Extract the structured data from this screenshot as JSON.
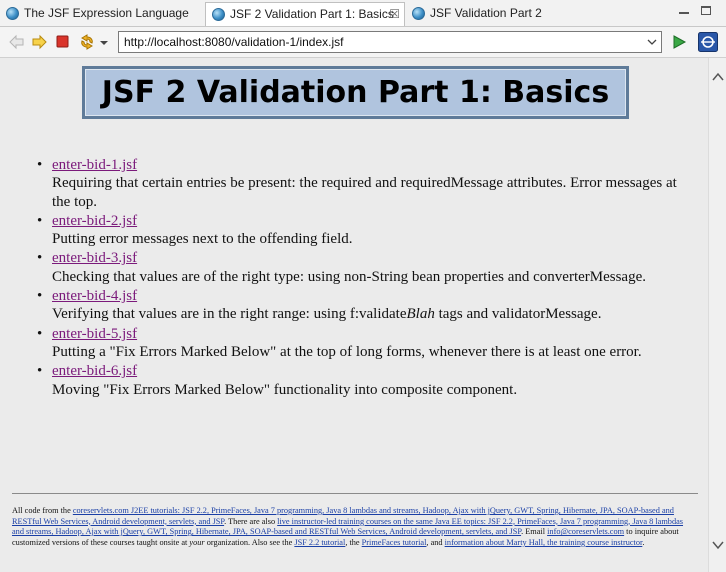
{
  "tabs": [
    {
      "label": "The JSF Expression Language"
    },
    {
      "label": "JSF 2 Validation Part 1: Basics",
      "close": "☒"
    },
    {
      "label": "JSF Validation Part 2"
    }
  ],
  "toolbar": {
    "url": "http://localhost:8080/validation-1/index.jsf"
  },
  "page": {
    "title": "JSF 2 Validation Part 1: Basics",
    "items": [
      {
        "link": "enter-bid-1.jsf",
        "desc": "Requiring that certain entries be present: the required and requiredMessage attributes. Error messages at the top."
      },
      {
        "link": "enter-bid-2.jsf",
        "desc": "Putting error messages next to the offending field."
      },
      {
        "link": "enter-bid-3.jsf",
        "desc": "Checking that values are of the right type: using non-String bean properties and converterMessage."
      },
      {
        "link": "enter-bid-4.jsf",
        "desc_pre": "Verifying that values are in the right range: using f:validate",
        "desc_em": "Blah",
        "desc_post": " tags and validatorMessage."
      },
      {
        "link": "enter-bid-5.jsf",
        "desc": "Putting a \"Fix Errors Marked Below\" at the top of long forms, whenever there is at least one error."
      },
      {
        "link": "enter-bid-6.jsf",
        "desc": "Moving \"Fix Errors Marked Below\" functionality into composite component."
      }
    ]
  },
  "footer": {
    "t1": "All code from the ",
    "l1": "coreservlets.com J2EE tutorials: JSF 2.2, PrimeFaces, Java 7 programming, Java 8 lambdas and streams, Hadoop, Ajax with jQuery, GWT, Spring, Hibernate, JPA, SOAP-based and RESTful Web Services, Android development, servlets, and JSP",
    "t2": ". There are also ",
    "l2": "live instructor-led training courses on the same Java EE topics: JSF 2.2, PrimeFaces, Java 7 programming, Java 8 lambdas and streams, Hadoop, Ajax with jQuery, GWT, Spring, Hibernate, JPA, SOAP-based and RESTful Web Services, Android development, servlets, and JSP",
    "t3": ". Email ",
    "l3": "info@coreservlets.com",
    "t4": " to inquire about customized versions of these courses taught onsite at ",
    "t4em": "your",
    "t5": " organization. Also see the ",
    "l4": "JSF 2.2 tutorial",
    "t6": ", the ",
    "l5": "PrimeFaces tutorial",
    "t7": ", and ",
    "l6": "information about Marty Hall, the training course instructor",
    "t8": "."
  },
  "colors": {
    "title_bg": "#b0c4de",
    "link_visited": "#7b1a7b",
    "footer_link": "#1a3fa6"
  },
  "icons": [
    "globe-icon",
    "close-icon",
    "back-icon",
    "forward-icon",
    "stop-icon",
    "refresh-icon",
    "go-icon",
    "browser-icon"
  ]
}
